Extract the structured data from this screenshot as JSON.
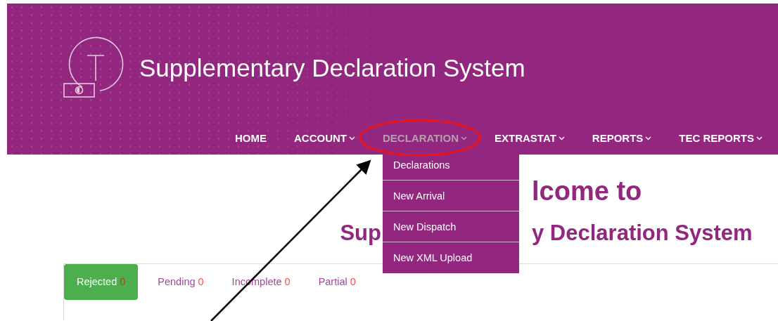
{
  "header": {
    "title": "Supplementary Declaration System"
  },
  "nav": [
    {
      "label": "HOME",
      "has_caret": false,
      "selected": false
    },
    {
      "label": "ACCOUNT",
      "has_caret": true,
      "selected": false
    },
    {
      "label": "DECLARATION",
      "has_caret": true,
      "selected": true
    },
    {
      "label": "EXTRASTAT",
      "has_caret": true,
      "selected": false
    },
    {
      "label": "REPORTS",
      "has_caret": true,
      "selected": false
    },
    {
      "label": "TEC REPORTS",
      "has_caret": true,
      "selected": false
    }
  ],
  "dropdown": [
    "Declarations",
    "New Arrival",
    "New Dispatch",
    "New XML Upload"
  ],
  "welcome": {
    "line_1_visible_right": "lcome to",
    "line_2_visible_left": "Sup",
    "line_2_visible_right": "y Declaration System"
  },
  "tabs": [
    {
      "label": "Rejected",
      "count": "0",
      "selected": true
    },
    {
      "label": "Pending",
      "count": "0",
      "selected": false
    },
    {
      "label": "Incomplete",
      "count": "0",
      "selected": false
    },
    {
      "label": "Partial",
      "count": "0",
      "selected": false
    }
  ]
}
